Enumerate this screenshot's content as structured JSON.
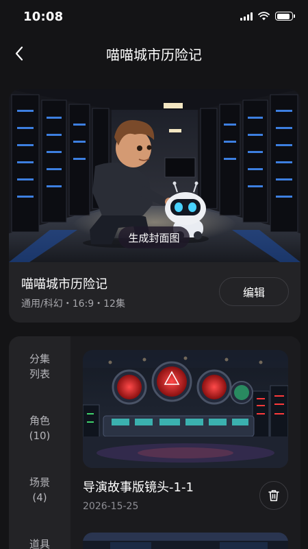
{
  "status_bar": {
    "time": "10:08",
    "icons": [
      "cellular-signal-icon",
      "wifi-icon",
      "battery-icon"
    ],
    "battery_level": 0.9
  },
  "nav": {
    "back_icon": "chevron-left-icon",
    "title": "喵喵城市历险记"
  },
  "project": {
    "cover_button": "生成封面图",
    "title": "喵喵城市历险记",
    "meta": "通用/科幻・16:9・12集",
    "edit_button": "编辑"
  },
  "sidebar": {
    "items": [
      {
        "label": "分集\n列表"
      },
      {
        "label": "角色\n(10)"
      },
      {
        "label": "场景\n(4)"
      },
      {
        "label": "道具"
      }
    ]
  },
  "episodes": [
    {
      "title": "导演故事版镜头-1-1",
      "date": "2026-15-25",
      "delete_icon": "trash-icon"
    }
  ],
  "colors": {
    "background": "#141416",
    "card": "#232326",
    "secondary_text": "#a6a6ab"
  }
}
